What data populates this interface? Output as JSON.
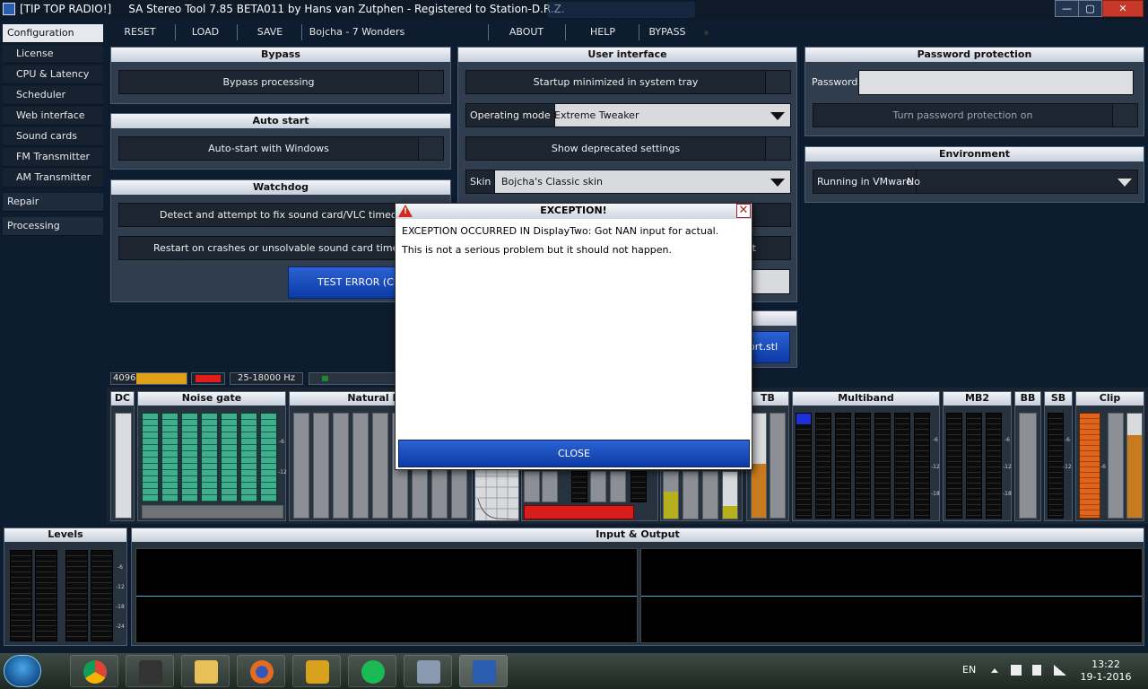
{
  "window": {
    "app_tag": "[TIP TOP RADIO!]",
    "title": "SA Stereo Tool 7.85 BETA011 by Hans van Zutphen - Registered to Station-D.R.Z.",
    "controls": {
      "minimize": "—",
      "maximize": "▢",
      "close": "✕"
    }
  },
  "sidebar": {
    "configuration": "Configuration",
    "items": [
      "License",
      "CPU & Latency",
      "Scheduler",
      "Web interface",
      "Sound cards",
      "FM Transmitter",
      "AM Transmitter"
    ],
    "repair": "Repair",
    "processing": "Processing"
  },
  "menu": {
    "reset": "RESET",
    "load": "LOAD",
    "save": "SAVE",
    "preset": "Bojcha - 7 Wonders",
    "about": "ABOUT",
    "help": "HELP",
    "bypass": "BYPASS"
  },
  "bypass": {
    "title": "Bypass",
    "bypass_processing": "Bypass processing"
  },
  "auto_start": {
    "title": "Auto start",
    "auto_start_windows": "Auto-start with Windows"
  },
  "watchdog": {
    "title": "Watchdog",
    "detect_fix": "Detect and attempt to fix sound card/VLC timeouts",
    "restart_crash": "Restart on crashes or unsolvable sound card timeouts",
    "test_error": "TEST ERROR (CRA"
  },
  "user_interface": {
    "title": "User interface",
    "startup_minimized": "Startup minimized in system tray",
    "operating_mode_label": "Operating mode",
    "operating_mode_value": "Extreme Tweaker",
    "show_deprecated": "Show deprecated settings",
    "skin_label": "Skin",
    "skin_value": "Bojcha's Classic skin",
    "partial_t": "t",
    "partial_file": "ort.stl"
  },
  "password": {
    "title": "Password protection",
    "label": "Password",
    "value": "",
    "turn_on": "Turn password protection on"
  },
  "environment": {
    "title": "Environment",
    "vmware_label": "Running in VMware",
    "vmware_value": "No"
  },
  "status": {
    "samples": "4096",
    "range": "25-18000 Hz"
  },
  "meters": {
    "dc": "DC",
    "noise_gate": "Noise gate",
    "natural_dyn": "Natural Dyn",
    "tb": "TB",
    "multiband": "Multiband",
    "mb2": "MB2",
    "bb": "BB",
    "sb": "SB",
    "clip": "Clip",
    "levels": "Levels",
    "input_output": "Input & Output",
    "ticks": [
      "-6",
      "-12",
      "-18",
      "-24"
    ]
  },
  "dialog": {
    "title": "EXCEPTION!",
    "warning_glyph": "!",
    "close_x": "✕",
    "message_line1": "EXCEPTION OCCURRED IN DisplayTwo: Got NAN input for actual.",
    "message_line2": "This is not a serious problem but it should not happen.",
    "close_button": "CLOSE"
  },
  "taskbar": {
    "language": "EN",
    "time": "13:22",
    "date": "19-1-2016",
    "apps": [
      "chrome-icon",
      "mediaplayer-icon",
      "explorer-icon",
      "firefox-icon",
      "winamp-icon",
      "spotify-icon",
      "installer-icon",
      "stereotool-icon"
    ]
  },
  "colors": {
    "background": "#0d1c2e",
    "panel": "#303d4e",
    "dialog_button": "#0c3aa5",
    "warning_red": "#d32a1e",
    "meter_green": "#3fae8c",
    "meter_orange": "#e0641a",
    "meter_amber": "#c87a1f"
  }
}
